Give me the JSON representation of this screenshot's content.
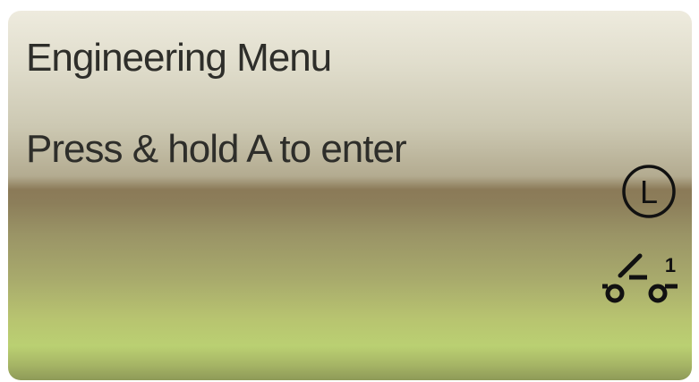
{
  "display": {
    "title": "Engineering Menu",
    "prompt": "Press & hold A to enter"
  },
  "status_icons": {
    "mode_letter": "L",
    "mode_icon": "circled-letter-icon",
    "switch_icon": "switch-contact-icon",
    "switch_number": "1"
  },
  "colors": {
    "text": "#2e2e2a",
    "icon": "#111111",
    "top_gradient": "#eeebde",
    "band": "#8b7a58",
    "bottom_green": "#bad072"
  }
}
